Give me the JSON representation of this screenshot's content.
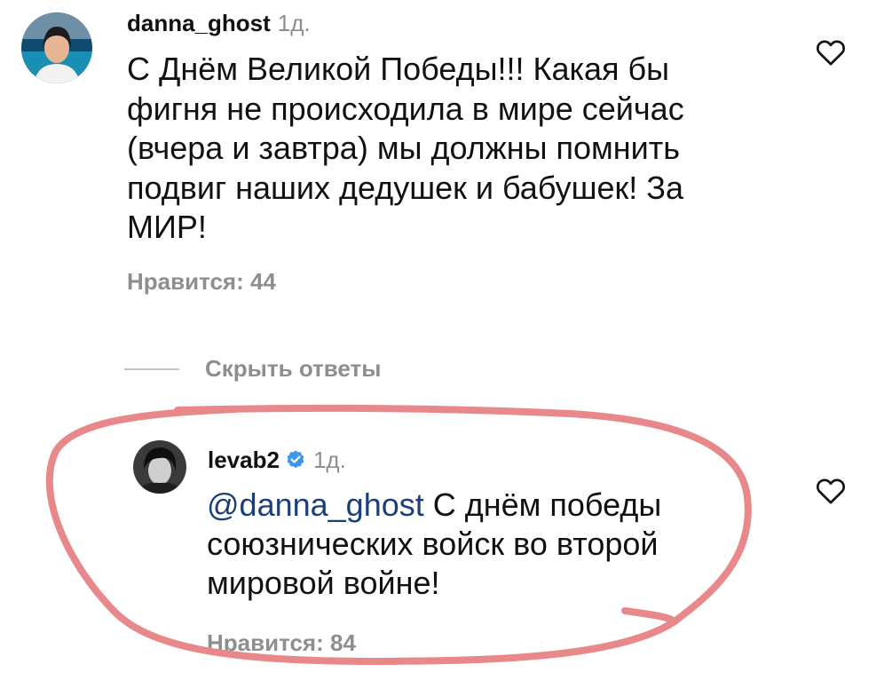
{
  "comments": [
    {
      "username": "danna_ghost",
      "time": "1д.",
      "text": "С Днём Великой Победы!!! Какая бы фигня не происходила в мире сейчас (вчера и завтра) мы должны помнить подвиг наших дедушек и бабушек! За МИР!",
      "likes": "Нравится: 44",
      "like_icon": "heart-outline-icon"
    }
  ],
  "replies_toggle": "Скрыть ответы",
  "reply": {
    "username": "levab2",
    "verified_icon": "verified-badge-icon",
    "time": "1д.",
    "mention": "@danna_ghost",
    "text": " С днём победы союзнических войск во второй мировой войне!",
    "likes": "Нравится: 84",
    "like_icon": "heart-outline-icon"
  },
  "colors": {
    "mention": "#1d3f78",
    "verified": "#3897f0",
    "secondary_text": "#8e8e8e",
    "annotation_loop": "#e8888a"
  }
}
